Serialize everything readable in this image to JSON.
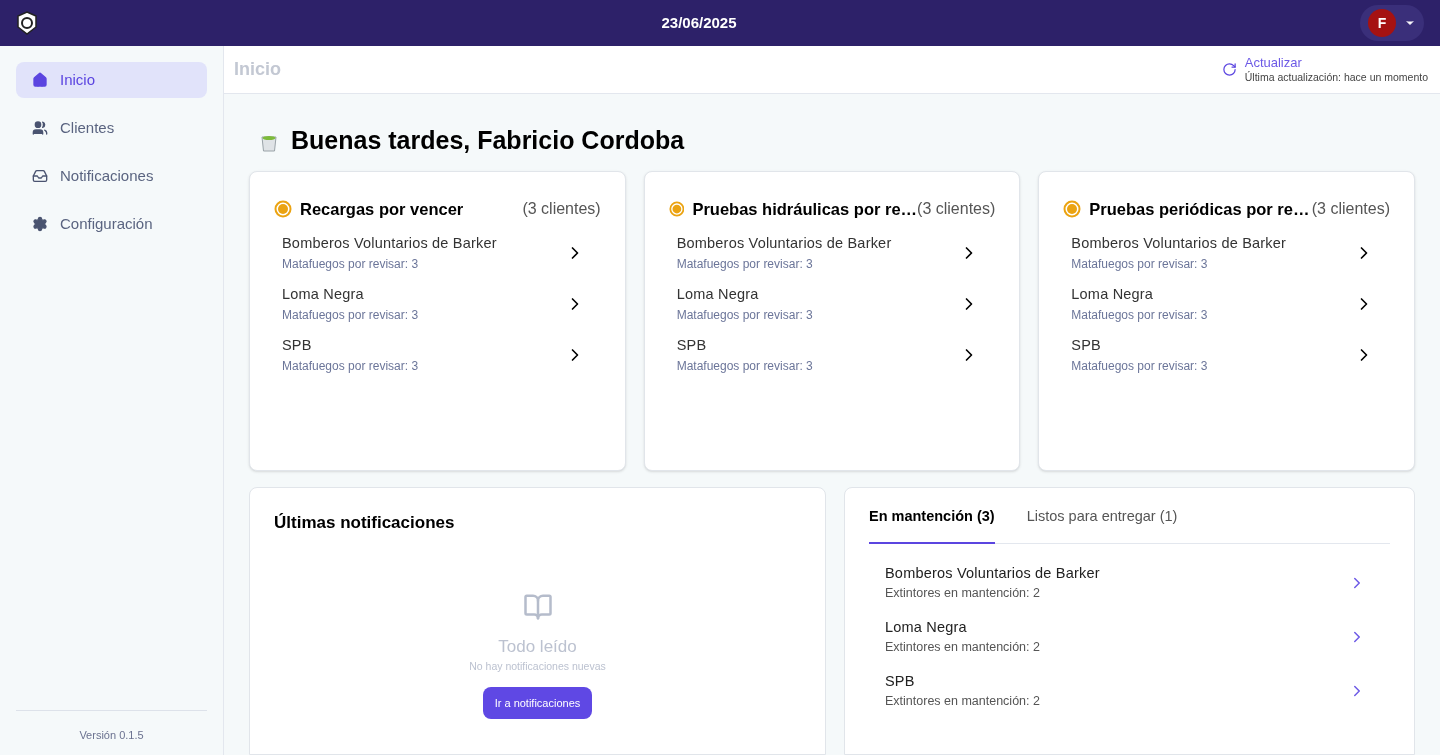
{
  "header": {
    "date": "23/06/2025",
    "avatar_initial": "F"
  },
  "sidebar": {
    "items": [
      {
        "label": "Inicio",
        "kind": "home",
        "selected": true
      },
      {
        "label": "Clientes",
        "kind": "clients",
        "selected": false
      },
      {
        "label": "Notificaciones",
        "kind": "inbox",
        "selected": false
      },
      {
        "label": "Configuración",
        "kind": "settings",
        "selected": false
      }
    ],
    "version": "Versión 0.1.5"
  },
  "topbar": {
    "title": "Inicio",
    "refresh_label": "Actualizar",
    "last_update": "Última actualización: hace un momento"
  },
  "greeting": "Buenas tardes, Fabricio Cordoba",
  "cards": [
    {
      "title": "Recargas por vencer",
      "count": "(3 clientes)",
      "items": [
        {
          "name": "Bomberos Voluntarios de Barker",
          "detail": "Matafuegos por revisar: 3"
        },
        {
          "name": "Loma Negra",
          "detail": "Matafuegos por revisar: 3"
        },
        {
          "name": "SPB",
          "detail": "Matafuegos por revisar: 3"
        }
      ]
    },
    {
      "title": "Pruebas hidráulicas por re…",
      "count": "(3 clientes)",
      "items": [
        {
          "name": "Bomberos Voluntarios de Barker",
          "detail": "Matafuegos por revisar: 3"
        },
        {
          "name": "Loma Negra",
          "detail": "Matafuegos por revisar: 3"
        },
        {
          "name": "SPB",
          "detail": "Matafuegos por revisar: 3"
        }
      ]
    },
    {
      "title": "Pruebas periódicas por re…",
      "count": "(3 clientes)",
      "items": [
        {
          "name": "Bomberos Voluntarios de Barker",
          "detail": "Matafuegos por revisar: 3"
        },
        {
          "name": "Loma Negra",
          "detail": "Matafuegos por revisar: 3"
        },
        {
          "name": "SPB",
          "detail": "Matafuegos por revisar: 3"
        }
      ]
    }
  ],
  "notifications": {
    "title": "Últimas notificaciones",
    "empty_title": "Todo leído",
    "empty_text": "No hay notificaciones nuevas",
    "button": "Ir a notificaciones"
  },
  "maintenance": {
    "tabs": [
      {
        "label": "En mantención (3)",
        "selected": true
      },
      {
        "label": "Listos para entregar (1)",
        "selected": false
      }
    ],
    "items": [
      {
        "name": "Bomberos Voluntarios de Barker",
        "detail": "Extintores en mantención: 2"
      },
      {
        "name": "Loma Negra",
        "detail": "Extintores en mantención: 2"
      },
      {
        "name": "SPB",
        "detail": "Extintores en mantención: 2"
      }
    ]
  }
}
